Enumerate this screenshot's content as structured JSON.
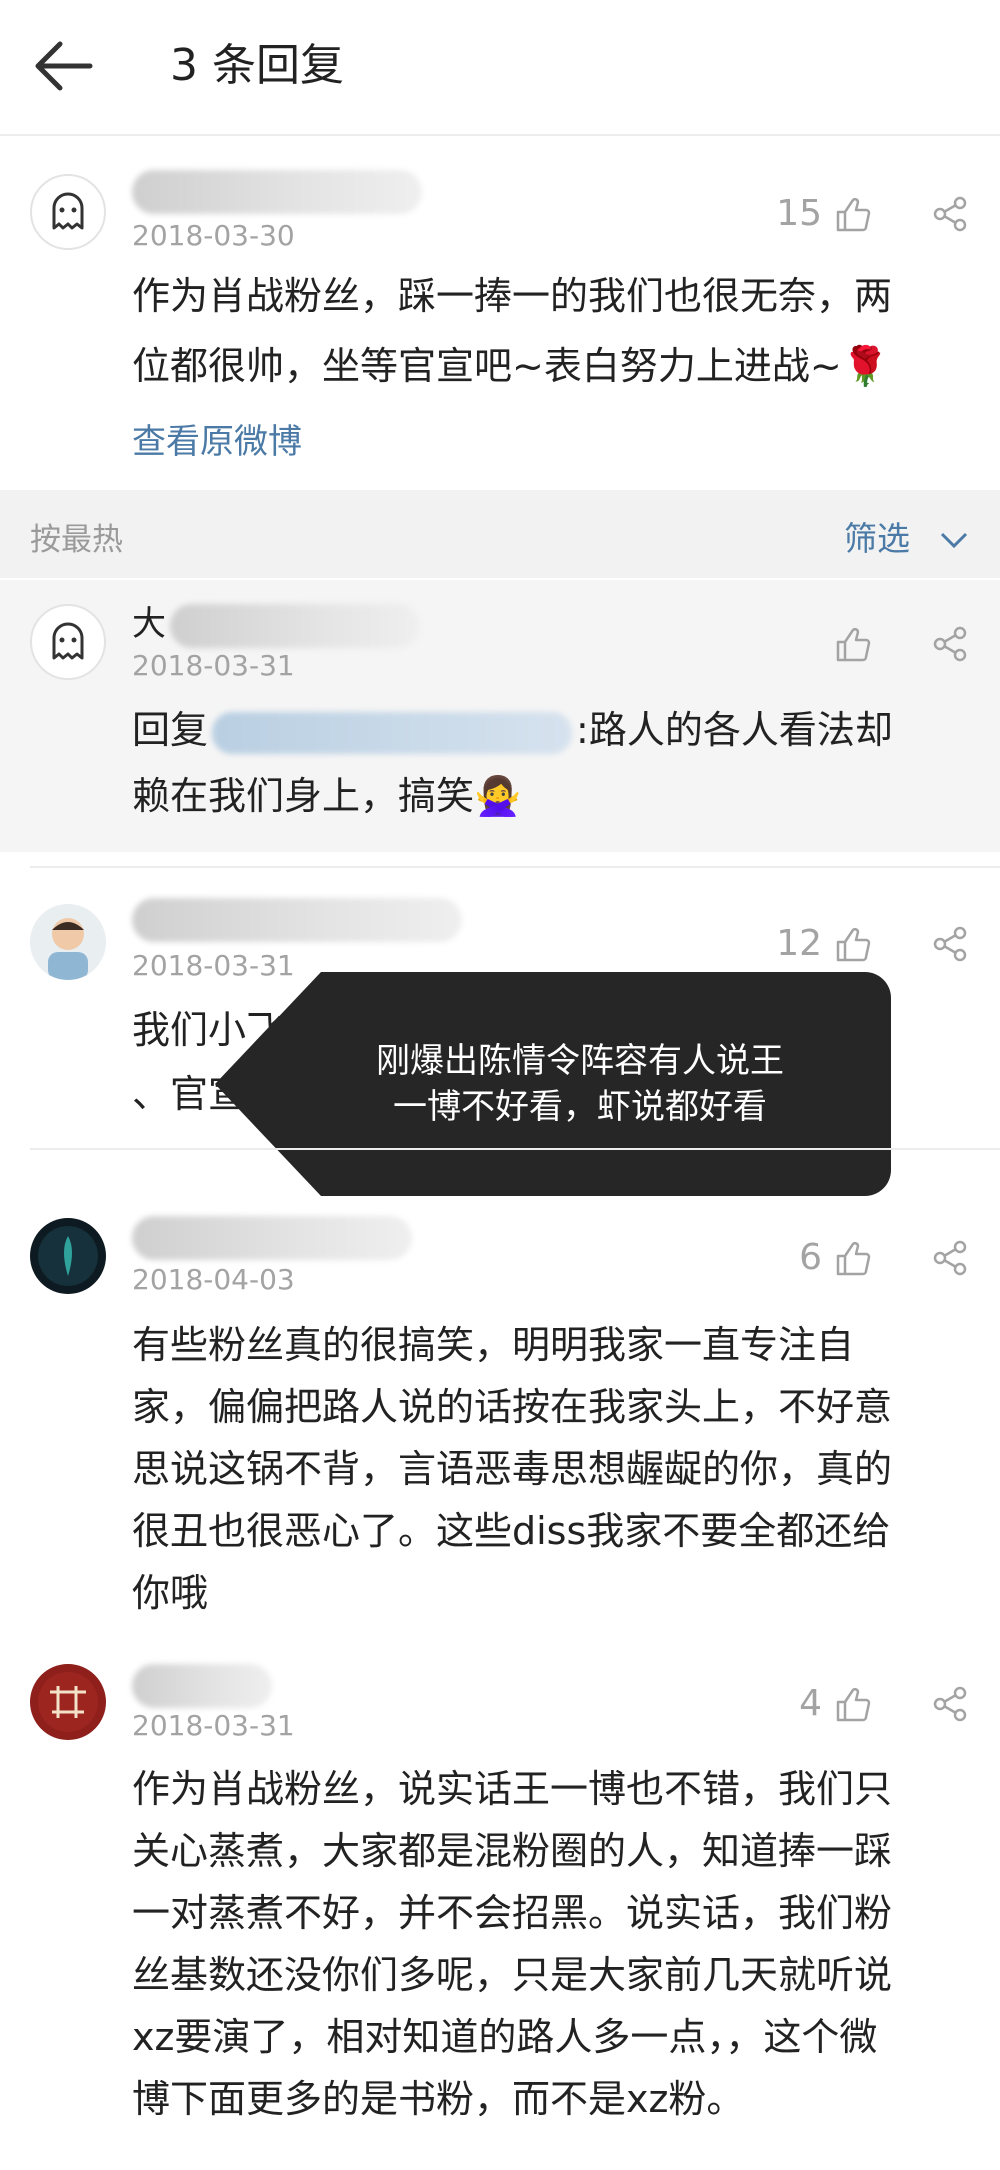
{
  "header": {
    "title": "3 条回复"
  },
  "original": {
    "date": "2018-03-30",
    "likes": "15",
    "text_line1": "作为肖战粉丝，踩一捧一的我们也很无奈，两",
    "text_line2": "位都很帅，坐等官宣吧~表白努力上进战~",
    "view_original": "查看原微博"
  },
  "filter": {
    "sort_label": "按最热",
    "filter_label": "筛选"
  },
  "comments": [
    {
      "name_visible": "大",
      "date": "2018-03-31",
      "likes": "",
      "reply_prefix": "回复",
      "line1_tail": ":路人的各人看法却",
      "line2": "赖在我们身上，搞笑"
    },
    {
      "date": "2018-03-31",
      "likes": "12",
      "line1": "我们小飞侠觉得肖战和王一博都挺帅的，都只",
      "line2": "、官宣奥"
    },
    {
      "date": "2018-04-03",
      "likes": "6",
      "lines": [
        "有些粉丝真的很搞笑，明明我家一直专注自",
        "家，偏偏把路人说的话按在我家头上，不好意",
        "思说这锅不背，言语恶毒思想龌龊的你，真的",
        "很丑也很恶心了。这些diss我家不要全都还给",
        "你哦"
      ]
    },
    {
      "date": "2018-03-31",
      "likes": "4",
      "lines": [
        "作为肖战粉丝，说实话王一博也不错，我们只",
        "关心蒸煮，大家都是混粉圈的人，知道捧一踩",
        "一对蒸煮不好，并不会招黑。说实话，我们粉",
        "丝基数还没你们多呢，只是大家前几天就听说",
        "xz要演了，相对知道的路人多一点，，这个微",
        "博下面更多的是书粉，而不是xz粉。"
      ]
    }
  ],
  "tooltip": {
    "line1": "刚爆出陈情令阵容有人说王",
    "line2": "一博不好看，虾说都好看"
  },
  "colors": {
    "link": "#4b7aa6",
    "muted": "#a3a3a3",
    "tooltip_bg": "#262626"
  },
  "icons": [
    "back-arrow-icon",
    "ghost-avatar-icon",
    "thumbs-up-icon",
    "share-icon",
    "chevron-down-icon"
  ]
}
